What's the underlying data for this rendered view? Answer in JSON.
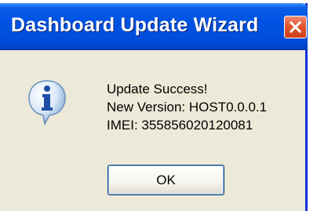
{
  "window": {
    "title": "Dashboard Update Wizard",
    "close_icon": "close-icon"
  },
  "message": {
    "icon": "info-icon",
    "lines": [
      "Update Success!",
      "New Version: HOST0.0.0.1",
      "IMEI: 355856020120081"
    ]
  },
  "buttons": {
    "ok_label": "OK"
  },
  "colors": {
    "titlebar": "#0054e3",
    "dialog_background": "#ece9d8",
    "close_button": "#e2552f"
  }
}
